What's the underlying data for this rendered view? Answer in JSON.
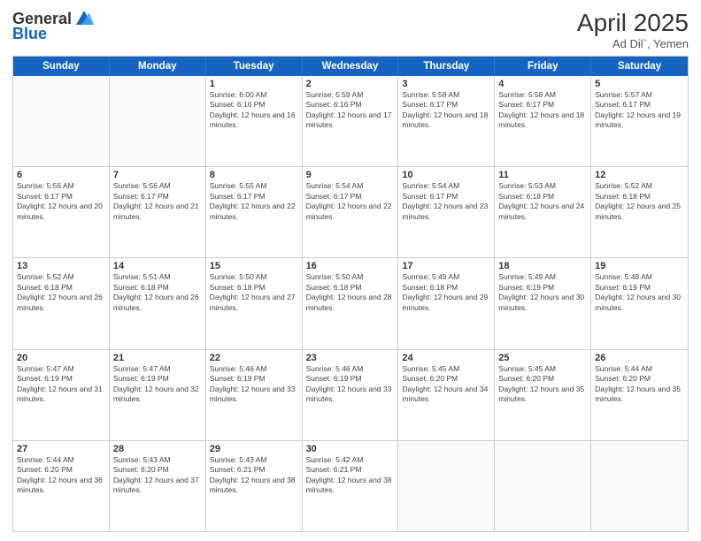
{
  "header": {
    "logo_general": "General",
    "logo_blue": "Blue",
    "month_year": "April 2025",
    "location": "Ad Dil`, Yemen"
  },
  "days_of_week": [
    "Sunday",
    "Monday",
    "Tuesday",
    "Wednesday",
    "Thursday",
    "Friday",
    "Saturday"
  ],
  "rows": [
    [
      {
        "day": "",
        "empty": true
      },
      {
        "day": "",
        "empty": true
      },
      {
        "day": "1",
        "info": "Sunrise: 6:00 AM\nSunset: 6:16 PM\nDaylight: 12 hours and 16 minutes."
      },
      {
        "day": "2",
        "info": "Sunrise: 5:59 AM\nSunset: 6:16 PM\nDaylight: 12 hours and 17 minutes."
      },
      {
        "day": "3",
        "info": "Sunrise: 5:58 AM\nSunset: 6:17 PM\nDaylight: 12 hours and 18 minutes."
      },
      {
        "day": "4",
        "info": "Sunrise: 5:58 AM\nSunset: 6:17 PM\nDaylight: 12 hours and 18 minutes."
      },
      {
        "day": "5",
        "info": "Sunrise: 5:57 AM\nSunset: 6:17 PM\nDaylight: 12 hours and 19 minutes."
      }
    ],
    [
      {
        "day": "6",
        "info": "Sunrise: 5:56 AM\nSunset: 6:17 PM\nDaylight: 12 hours and 20 minutes."
      },
      {
        "day": "7",
        "info": "Sunrise: 5:56 AM\nSunset: 6:17 PM\nDaylight: 12 hours and 21 minutes."
      },
      {
        "day": "8",
        "info": "Sunrise: 5:55 AM\nSunset: 6:17 PM\nDaylight: 12 hours and 22 minutes."
      },
      {
        "day": "9",
        "info": "Sunrise: 5:54 AM\nSunset: 6:17 PM\nDaylight: 12 hours and 22 minutes."
      },
      {
        "day": "10",
        "info": "Sunrise: 5:54 AM\nSunset: 6:17 PM\nDaylight: 12 hours and 23 minutes."
      },
      {
        "day": "11",
        "info": "Sunrise: 5:53 AM\nSunset: 6:18 PM\nDaylight: 12 hours and 24 minutes."
      },
      {
        "day": "12",
        "info": "Sunrise: 5:52 AM\nSunset: 6:18 PM\nDaylight: 12 hours and 25 minutes."
      }
    ],
    [
      {
        "day": "13",
        "info": "Sunrise: 5:52 AM\nSunset: 6:18 PM\nDaylight: 12 hours and 26 minutes."
      },
      {
        "day": "14",
        "info": "Sunrise: 5:51 AM\nSunset: 6:18 PM\nDaylight: 12 hours and 26 minutes."
      },
      {
        "day": "15",
        "info": "Sunrise: 5:50 AM\nSunset: 6:18 PM\nDaylight: 12 hours and 27 minutes."
      },
      {
        "day": "16",
        "info": "Sunrise: 5:50 AM\nSunset: 6:18 PM\nDaylight: 12 hours and 28 minutes."
      },
      {
        "day": "17",
        "info": "Sunrise: 5:49 AM\nSunset: 6:18 PM\nDaylight: 12 hours and 29 minutes."
      },
      {
        "day": "18",
        "info": "Sunrise: 5:49 AM\nSunset: 6:19 PM\nDaylight: 12 hours and 30 minutes."
      },
      {
        "day": "19",
        "info": "Sunrise: 5:48 AM\nSunset: 6:19 PM\nDaylight: 12 hours and 30 minutes."
      }
    ],
    [
      {
        "day": "20",
        "info": "Sunrise: 5:47 AM\nSunset: 6:19 PM\nDaylight: 12 hours and 31 minutes."
      },
      {
        "day": "21",
        "info": "Sunrise: 5:47 AM\nSunset: 6:19 PM\nDaylight: 12 hours and 32 minutes."
      },
      {
        "day": "22",
        "info": "Sunrise: 5:46 AM\nSunset: 6:19 PM\nDaylight: 12 hours and 33 minutes."
      },
      {
        "day": "23",
        "info": "Sunrise: 5:46 AM\nSunset: 6:19 PM\nDaylight: 12 hours and 33 minutes."
      },
      {
        "day": "24",
        "info": "Sunrise: 5:45 AM\nSunset: 6:20 PM\nDaylight: 12 hours and 34 minutes."
      },
      {
        "day": "25",
        "info": "Sunrise: 5:45 AM\nSunset: 6:20 PM\nDaylight: 12 hours and 35 minutes."
      },
      {
        "day": "26",
        "info": "Sunrise: 5:44 AM\nSunset: 6:20 PM\nDaylight: 12 hours and 35 minutes."
      }
    ],
    [
      {
        "day": "27",
        "info": "Sunrise: 5:44 AM\nSunset: 6:20 PM\nDaylight: 12 hours and 36 minutes."
      },
      {
        "day": "28",
        "info": "Sunrise: 5:43 AM\nSunset: 6:20 PM\nDaylight: 12 hours and 37 minutes."
      },
      {
        "day": "29",
        "info": "Sunrise: 5:43 AM\nSunset: 6:21 PM\nDaylight: 12 hours and 38 minutes."
      },
      {
        "day": "30",
        "info": "Sunrise: 5:42 AM\nSunset: 6:21 PM\nDaylight: 12 hours and 38 minutes."
      },
      {
        "day": "",
        "empty": true
      },
      {
        "day": "",
        "empty": true
      },
      {
        "day": "",
        "empty": true
      }
    ]
  ]
}
